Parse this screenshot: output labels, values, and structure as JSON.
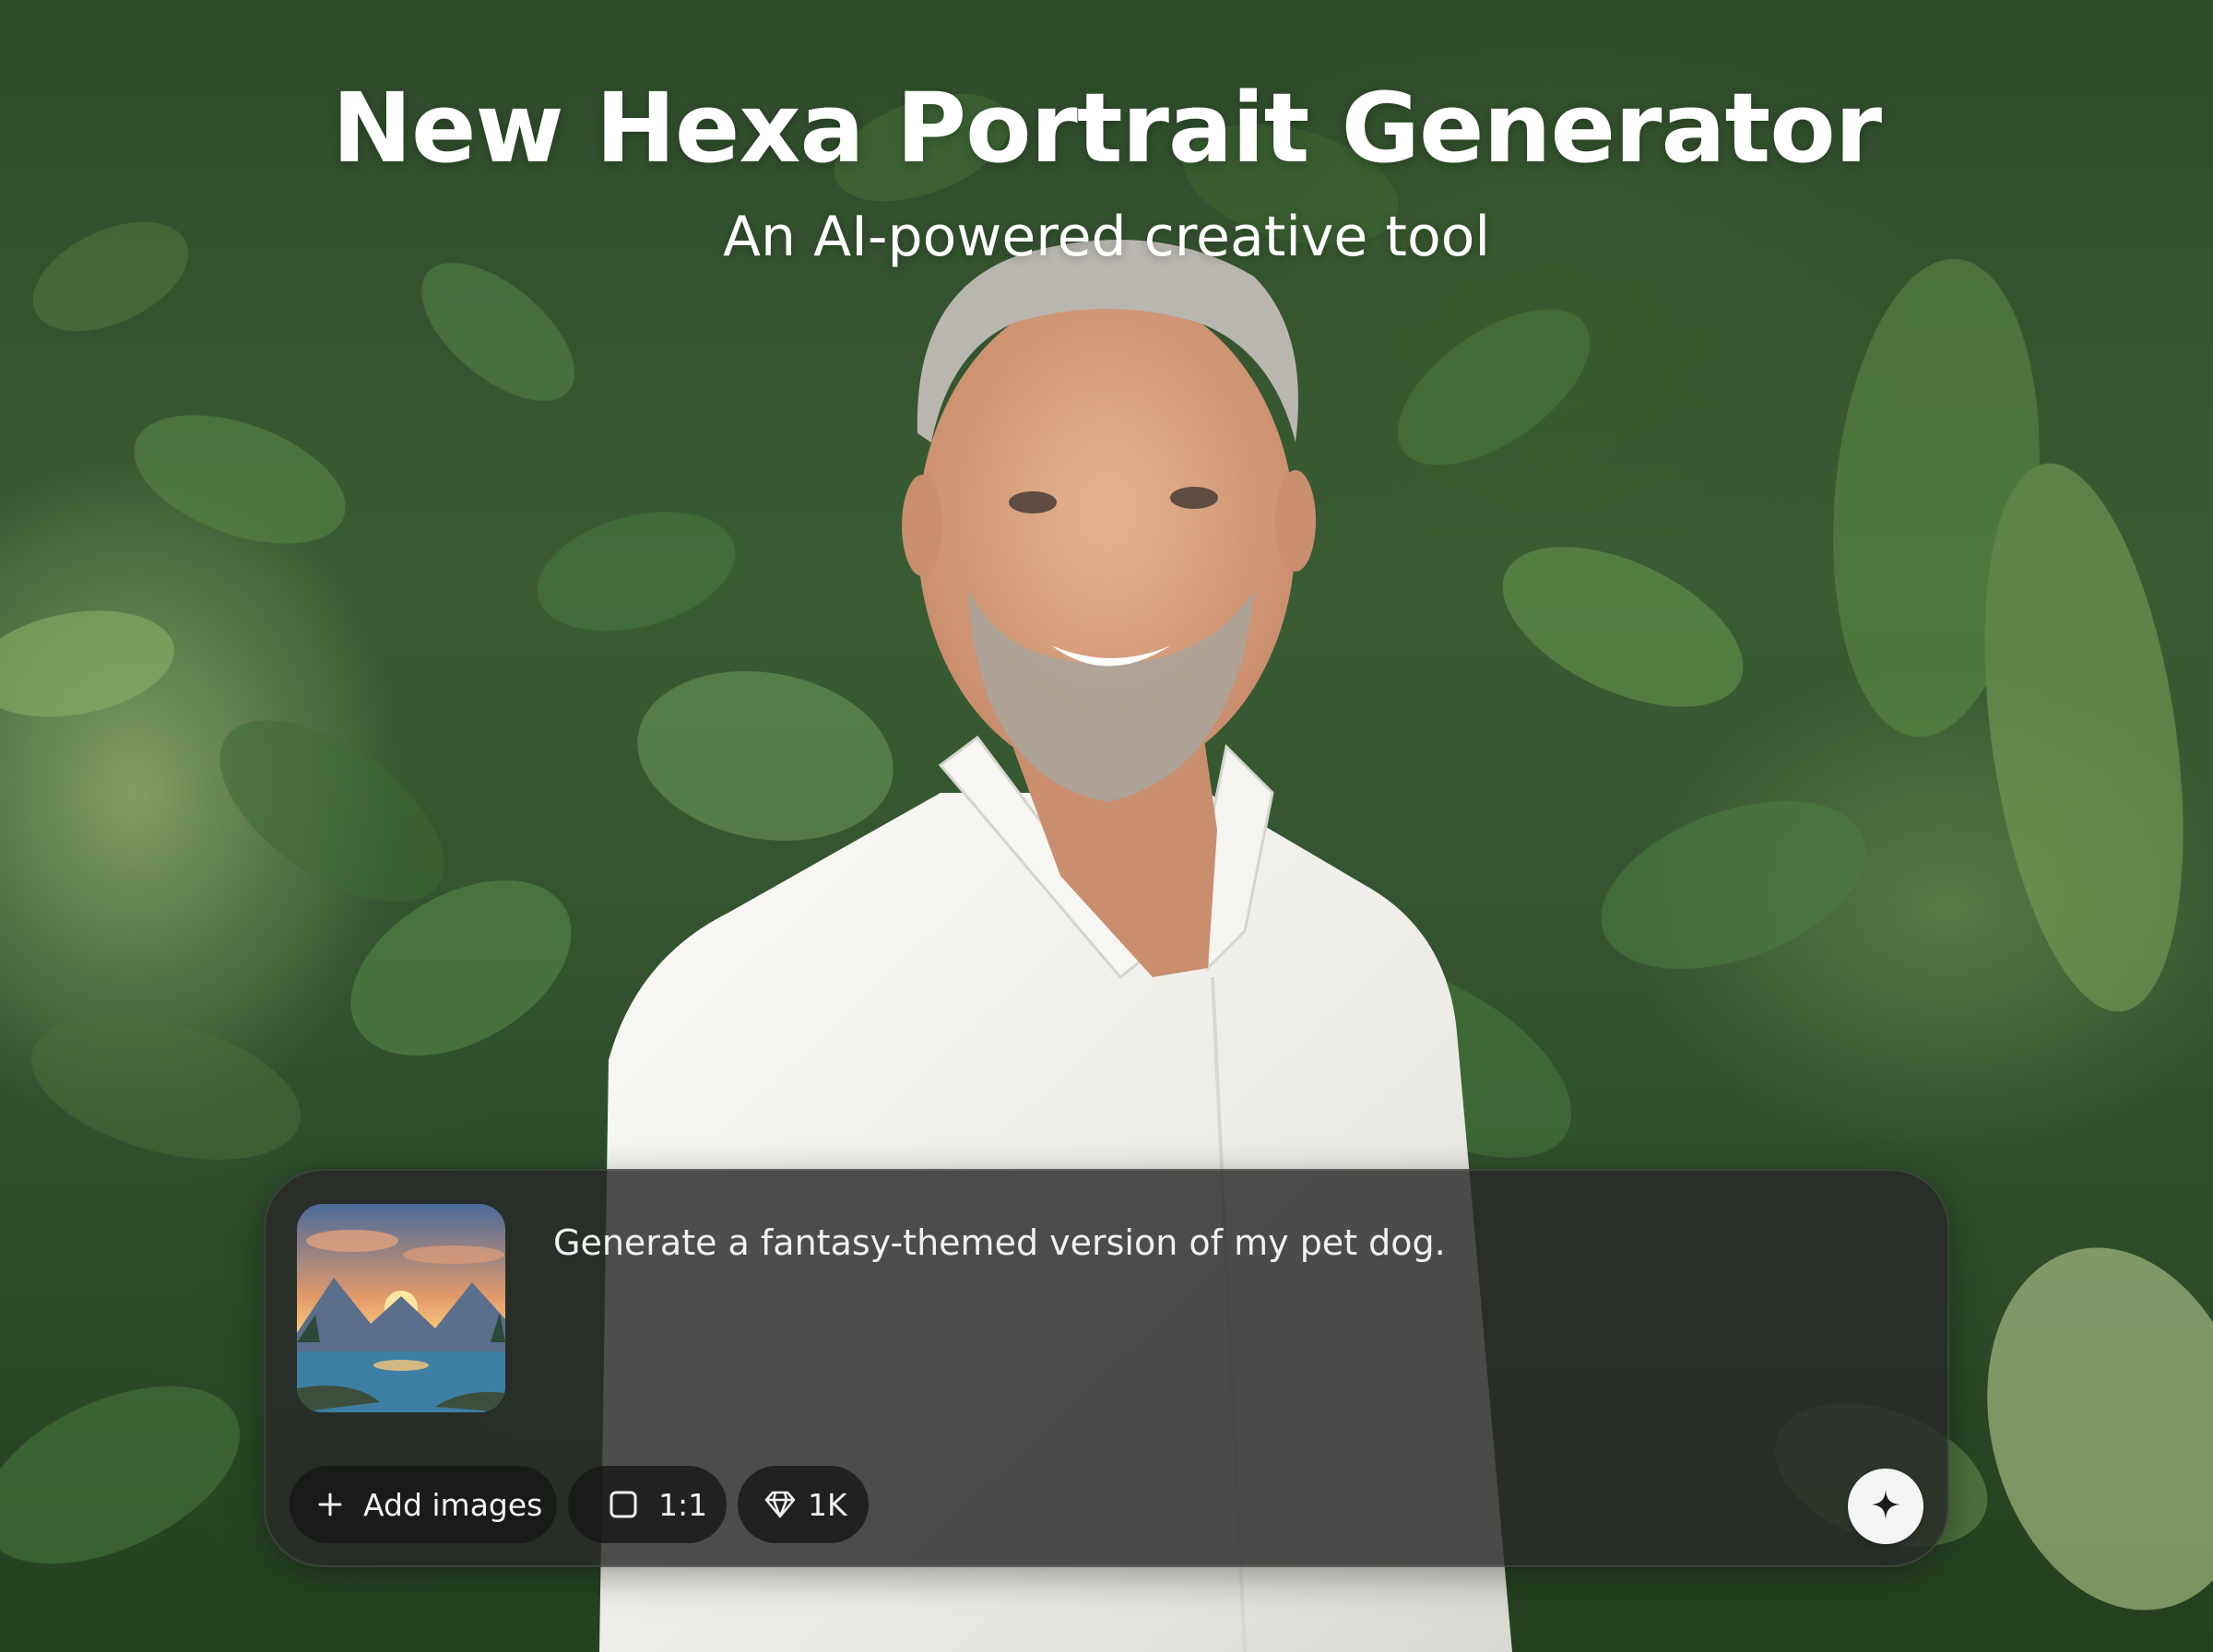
{
  "hero": {
    "title": "New Hexa Portrait Generator",
    "subtitle": "An AI-powered creative tool"
  },
  "prompt_box": {
    "text": "Generate a fantasy-themed version of my pet dog.",
    "thumbnail_icon": "sunset-lake-mountain-image",
    "add_images_label": "Add images",
    "add_images_icon": "plus-icon",
    "aspect_ratio_label": "1:1",
    "aspect_ratio_icon": "square-icon",
    "resolution_label": "1K",
    "resolution_icon": "diamond-icon",
    "send_icon": "sparkle-icon"
  },
  "colors": {
    "foliage": "#2f4f2c",
    "shirt": "#f3f1ec",
    "card": "#282828",
    "text": "#ffffff"
  }
}
